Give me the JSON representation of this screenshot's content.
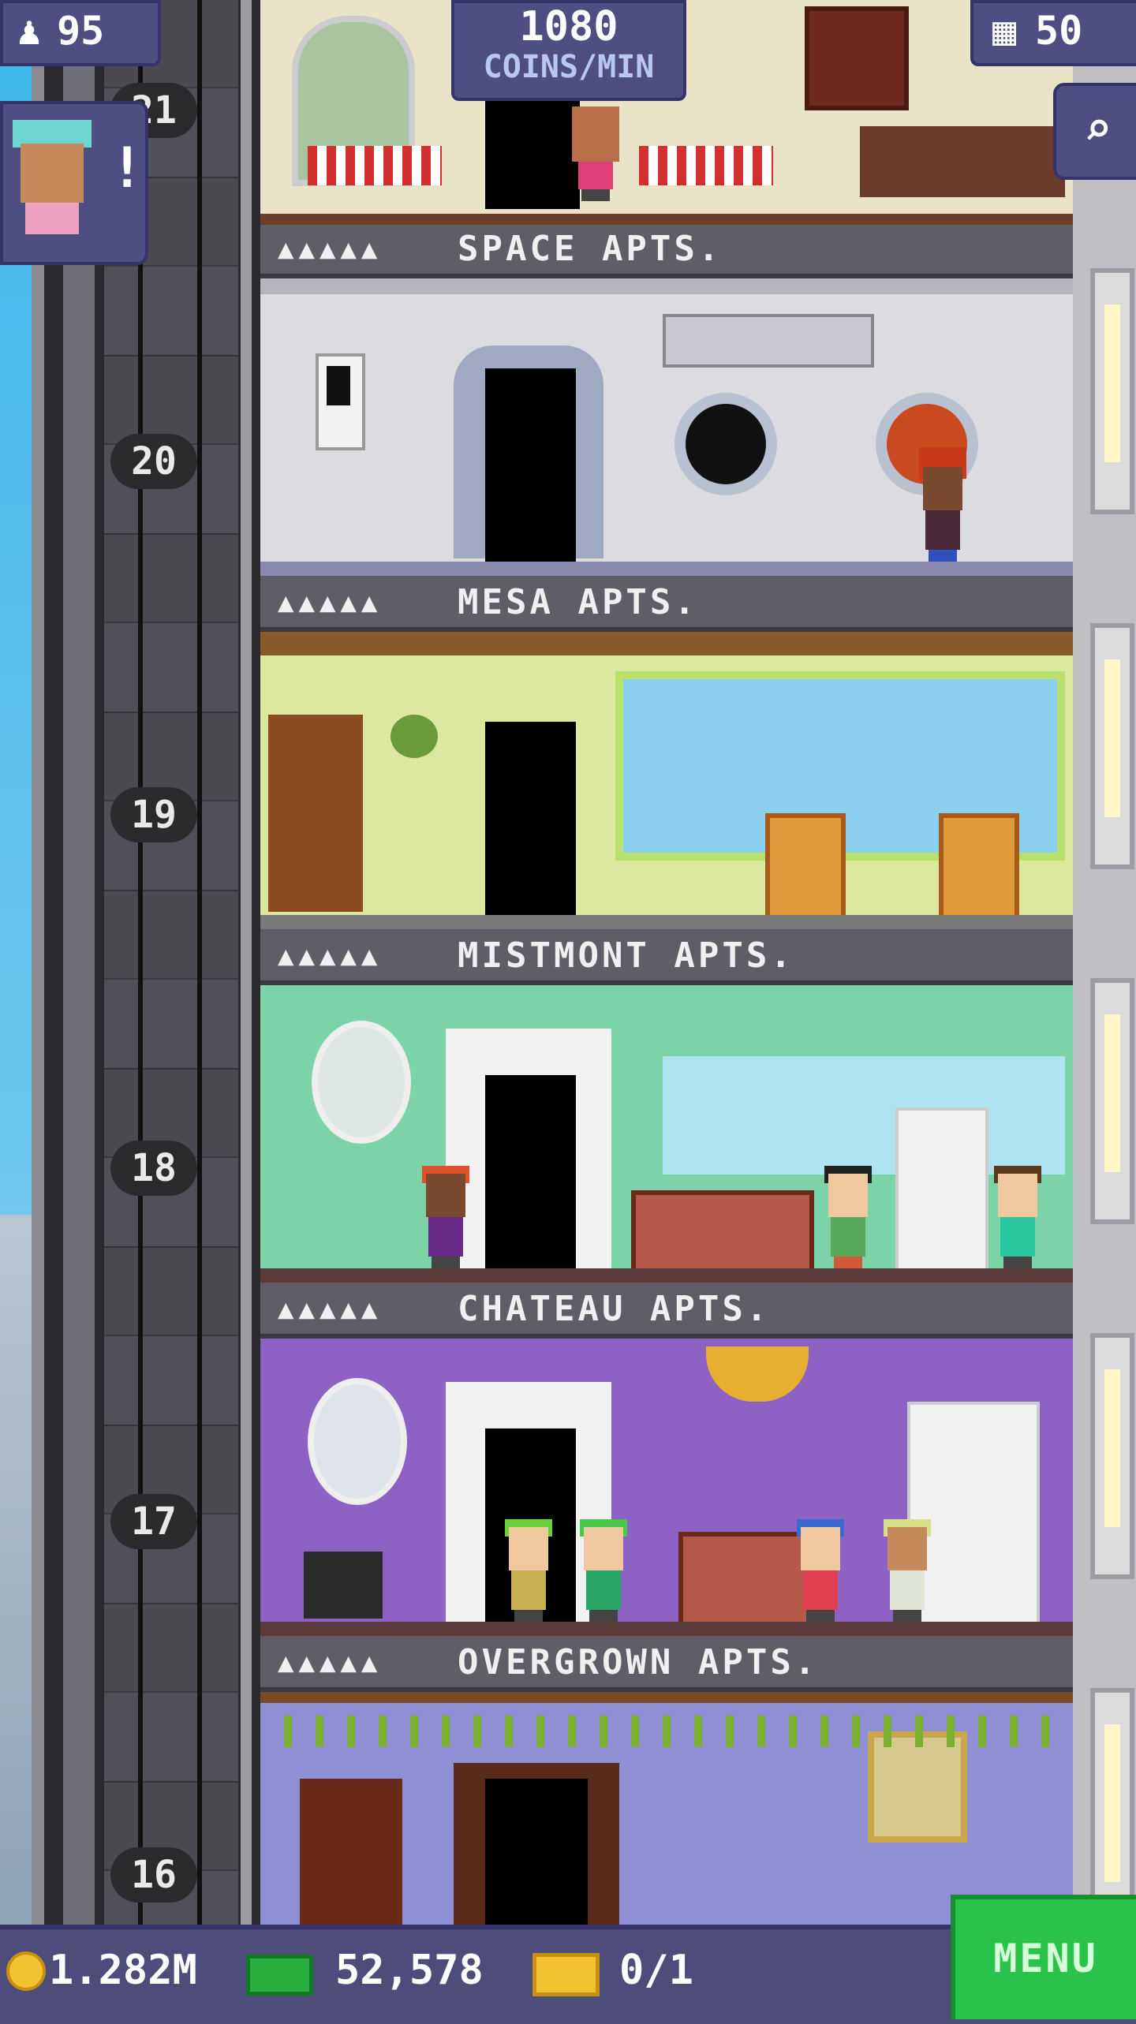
{
  "hud": {
    "population": "95",
    "coins_per_min_value": "1080",
    "coins_per_min_label": "COINS/MIN",
    "floors": "50",
    "notification_mark": "!"
  },
  "floors": [
    {
      "number": "20",
      "name": "SPACE APTS.",
      "occupancy_icons": "▲▲▲▲▲"
    },
    {
      "number": "19",
      "name": "MESA APTS.",
      "occupancy_icons": "▲▲▲▲▲"
    },
    {
      "number": "18",
      "name": "MISTMONT APTS.",
      "occupancy_icons": "▲▲▲▲▲"
    },
    {
      "number": "17",
      "name": "CHATEAU APTS.",
      "occupancy_icons": "▲▲▲▲▲"
    },
    {
      "number": "16",
      "name": "OVERGROWN APTS.",
      "occupancy_icons": "▲▲▲▲▲"
    }
  ],
  "top_floor_number": "21",
  "bottom": {
    "coins": "1.282M",
    "bux": "52,578",
    "tickets": "0/1",
    "menu_label": "MENU"
  },
  "colors": {
    "hud_bg": "#4f4e82",
    "menu_green": "#29c24a",
    "space_wall": "#d9d9de",
    "mesa_wall": "#dce8a0",
    "mistmont_wall": "#7dd3a8",
    "chateau_wall": "#8e62c4",
    "overgrown_wall": "#8f8fd6"
  }
}
